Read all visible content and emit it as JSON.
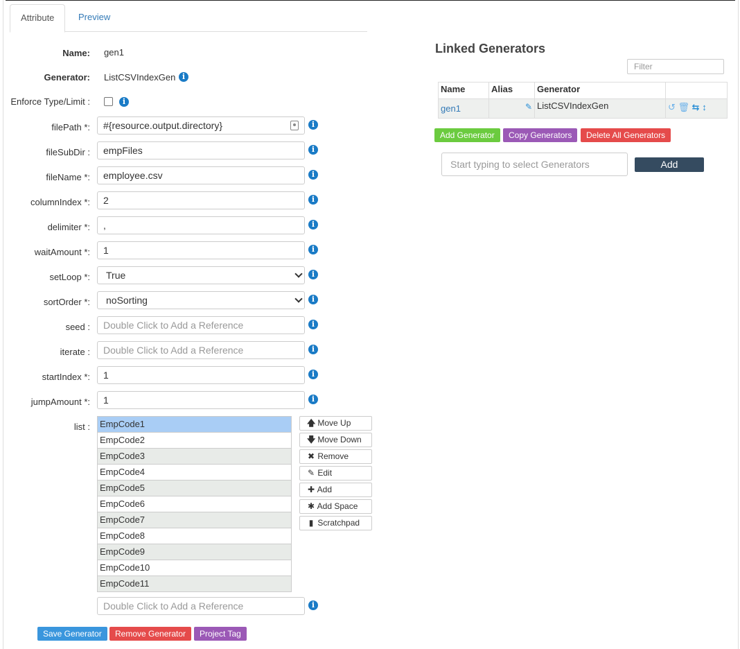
{
  "tabs": [
    {
      "label": "Attribute"
    },
    {
      "label": "Preview"
    }
  ],
  "form": {
    "name": {
      "label": "Name:",
      "value": "gen1"
    },
    "generator": {
      "label": "Generator:",
      "value": "ListCSVIndexGen"
    },
    "enforce": {
      "label": "Enforce Type/Limit :"
    },
    "filePath": {
      "label": "filePath *:",
      "value": "#{resource.output.directory}"
    },
    "fileSubDir": {
      "label": "fileSubDir :",
      "value": "empFiles"
    },
    "fileName": {
      "label": "fileName *:",
      "value": "employee.csv"
    },
    "columnIndex": {
      "label": "columnIndex *:",
      "value": "2"
    },
    "delimiter": {
      "label": "delimiter *:",
      "value": ","
    },
    "waitAmount": {
      "label": "waitAmount *:",
      "value": "1"
    },
    "setLoop": {
      "label": "setLoop *:",
      "value": "True"
    },
    "sortOrder": {
      "label": "sortOrder *:",
      "value": "noSorting"
    },
    "seed": {
      "label": "seed :",
      "placeholder": "Double Click to Add a Reference"
    },
    "iterate": {
      "label": "iterate :",
      "placeholder": "Double Click to Add a Reference"
    },
    "startIndex": {
      "label": "startIndex *:",
      "value": "1"
    },
    "jumpAmount": {
      "label": "jumpAmount *:",
      "value": "1"
    },
    "list": {
      "label": "list :",
      "placeholder": "Double Click to Add a Reference"
    }
  },
  "list_items": [
    "EmpCode1",
    "EmpCode2",
    "EmpCode3",
    "EmpCode4",
    "EmpCode5",
    "EmpCode6",
    "EmpCode7",
    "EmpCode8",
    "EmpCode9",
    "EmpCode10",
    "EmpCode11"
  ],
  "list_buttons": {
    "move_up": "Move Up",
    "move_down": "Move Down",
    "remove": "Remove",
    "edit": "Edit",
    "add": "Add",
    "add_space": "Add Space",
    "scratchpad": "Scratchpad"
  },
  "footer_buttons": {
    "save": "Save Generator",
    "remove": "Remove Generator",
    "project_tag": "Project Tag"
  },
  "linked": {
    "title": "Linked Generators",
    "filter_placeholder": "Filter",
    "columns": [
      "Name",
      "Alias",
      "Generator",
      ""
    ],
    "rows": [
      {
        "name": "gen1",
        "alias": "",
        "generator": "ListCSVIndexGen"
      }
    ],
    "buttons": {
      "add": "Add Generator",
      "copy": "Copy Generators",
      "delete_all": "Delete All Generators"
    },
    "select_placeholder": "Start typing to select Generators",
    "add_label": "Add"
  },
  "colors": {
    "info_blue": "#1a7bc6",
    "save_blue": "#3a96dd",
    "remove_red": "#e54b4b",
    "purple": "#9b59b6",
    "green": "#6bcb3f",
    "navy": "#354b60",
    "selected_row": "#a9cdf5"
  }
}
